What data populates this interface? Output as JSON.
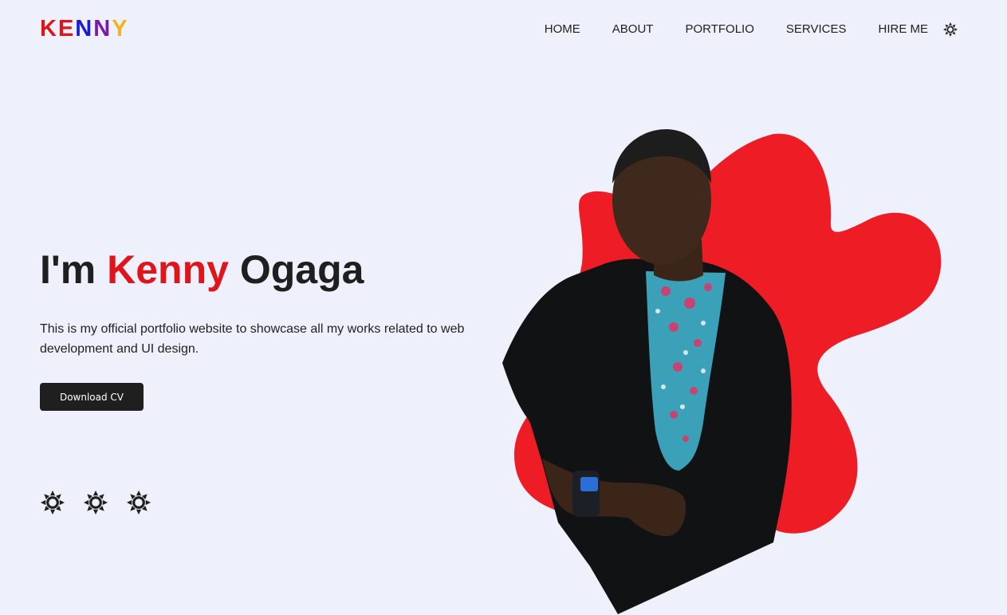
{
  "header": {
    "logo_letters": [
      {
        "char": "K",
        "color": "#e0141b"
      },
      {
        "char": "E",
        "color": "#e0141b"
      },
      {
        "char": "N",
        "color": "#1a1adb"
      },
      {
        "char": "N",
        "color": "#7a1aa8"
      },
      {
        "char": "Y",
        "color": "#f5b21a"
      }
    ],
    "nav": [
      {
        "label": "HOME"
      },
      {
        "label": "ABOUT"
      },
      {
        "label": "PORTFOLIO"
      },
      {
        "label": "SERVICES"
      },
      {
        "label": "HIRE ME"
      }
    ],
    "theme_toggle_icon": "sun-icon"
  },
  "hero": {
    "title_prefix": "I'm ",
    "title_accent": "Kenny",
    "title_suffix": " Ogaga",
    "description": "This is my official portfolio website to showcase all my works related to web development and UI design.",
    "cv_button_label": "Download CV",
    "socials": [
      {
        "icon": "sun-icon"
      },
      {
        "icon": "sun-icon"
      },
      {
        "icon": "sun-icon"
      }
    ],
    "image_alt": "profile-photo"
  },
  "colors": {
    "background": "#eef1fb",
    "accent": "#e0141b",
    "blob": "#ee1c25",
    "text": "#1f1f1f"
  }
}
